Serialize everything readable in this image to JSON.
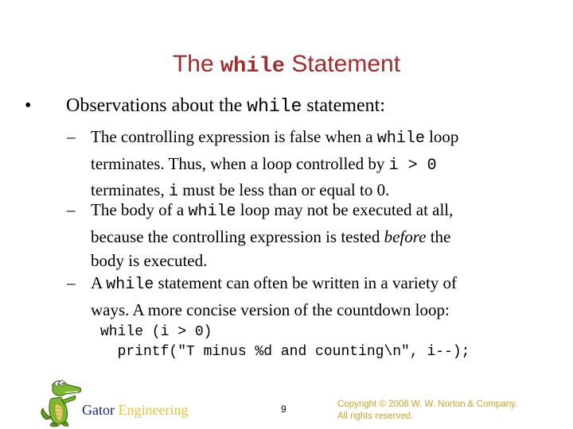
{
  "slide": {
    "title": {
      "before": "The ",
      "code": "while",
      "after": " Statement"
    },
    "bullet": {
      "marker": "•",
      "before": "Observations about the ",
      "code": "while",
      "after": " statement:"
    },
    "sub_bullets": [
      {
        "marker": "–",
        "line1_before": "The controlling expression is false when a ",
        "line1_code": "while",
        "line1_after": " loop",
        "line2_before": "terminates. Thus, when a loop controlled by ",
        "line2_code": "i > 0",
        "line3_code": "i",
        "line3_before": "terminates, ",
        "line3_after": " must be less than or equal to 0."
      },
      {
        "marker": "–",
        "line1_before": "The body of a ",
        "line1_code": "while",
        "line1_after": " loop may not be executed at all,",
        "line2_before": "because the controlling expression is tested ",
        "line2_em": "before",
        "line2_after": " the",
        "line3": "body is executed."
      },
      {
        "marker": "–",
        "line1_before": "A ",
        "line1_code": "while",
        "line1_after": " statement can often be written in a variety of",
        "line2": "ways. A more concise version of the countdown loop:"
      }
    ],
    "code_lines": [
      "while (i > 0)",
      "  printf(\"T minus %d and counting\\n\", i--);"
    ]
  },
  "footer": {
    "logo_icon": "gator-mascot-icon",
    "brand_first": "Gator",
    "brand_second": "Engineering",
    "page_number": "9",
    "copyright_line1": "Copyright © 2008 W. W. Norton & Company.",
    "copyright_line2": "All rights reserved."
  },
  "colors": {
    "title": "#a32b2b",
    "brand_gator": "#1a237e",
    "brand_engineering": "#e8c23a",
    "copyright": "#c9a227"
  }
}
